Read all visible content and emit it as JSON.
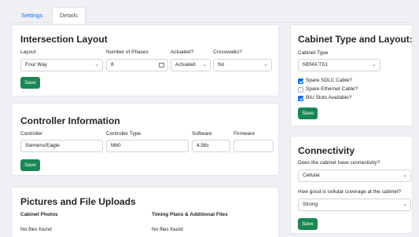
{
  "tabs": [
    {
      "label": "Settings",
      "active": false
    },
    {
      "label": "Details",
      "active": true
    }
  ],
  "intersection": {
    "title": "Intersection Layout",
    "layout_label": "Layout",
    "layout_value": "Four Way",
    "phases_label": "Number of Phases",
    "phases_value": "8",
    "actuated_label": "Actuated?",
    "actuated_value": "Actuated",
    "crosswalks_label": "Crosswalks?",
    "crosswalks_value": "No",
    "save_label": "Save"
  },
  "controller": {
    "title": "Controller Information",
    "controller_label": "Controller",
    "controller_value": "Siemens/Eagle",
    "type_label": "Controller Type",
    "type_value": "M60",
    "software_label": "Software",
    "software_value": "4.58c",
    "firmware_label": "Firmware",
    "firmware_value": "",
    "save_label": "Save"
  },
  "pictures": {
    "title": "Pictures and File Uploads",
    "photos_label": "Cabinet Photos",
    "photos_empty": "No files found",
    "plans_label": "Timing Plans & Additional Files",
    "plans_empty": "No files found"
  },
  "cabinet": {
    "title": "Cabinet Type and Layout:",
    "type_label": "Cabinet Type",
    "type_value": "NEMA TS1",
    "options": [
      {
        "label": "Spare SDLC Cable?",
        "checked": true
      },
      {
        "label": "Spare Ethernet Cable?",
        "checked": false
      },
      {
        "label": "BIU Slots Available?",
        "checked": true
      }
    ],
    "save_label": "Save"
  },
  "connectivity": {
    "title": "Connectivity",
    "q1_label": "Does the cabinet have connectivity?",
    "q1_value": "Cellular",
    "q2_label": "How good is cellular coverage at the cabinet?",
    "q2_value": "Strong",
    "save_label": "Save"
  },
  "colors": {
    "accent": "#0d6efd",
    "save_button": "#198754",
    "background": "#eef0f3"
  }
}
